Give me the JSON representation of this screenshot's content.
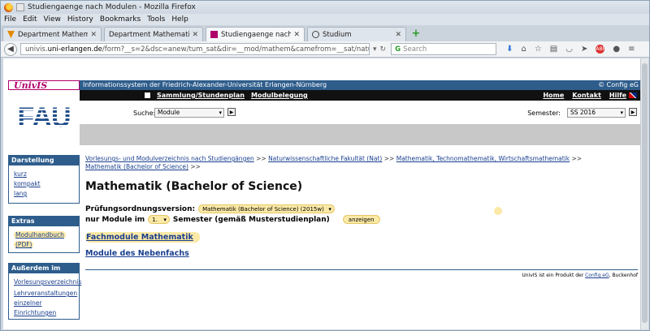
{
  "window": {
    "title": "Studiengaenge nach Modulen - Mozilla Firefox"
  },
  "menu": [
    "File",
    "Edit",
    "View",
    "History",
    "Bookmarks",
    "Tools",
    "Help"
  ],
  "tabs": [
    {
      "label": "Department Mathemati",
      "icon": "v-logo-icon"
    },
    {
      "label": "Department Mathematik > S",
      "icon": "blank-page-icon"
    },
    {
      "label": "Studiengaenge nach Mo",
      "icon": "univis-icon"
    },
    {
      "label": "Studium",
      "icon": "studium-icon"
    }
  ],
  "nav": {
    "url_pre": "univis.",
    "url_domain": "uni-erlangen.de",
    "url_rest": "/form?__s=2&dsc=anew/tum_sat&dir=__mod/mathem&camefrom=__sat/naturw/mathem&",
    "search_placeholder": "Search"
  },
  "univis": {
    "logo": "UnivIS",
    "banner": "Informationssystem der Friedrich-Alexander-Universität Erlangen-Nürnberg",
    "config": "© Config eG",
    "nav_left": [
      "Sammlung/Stundenplan",
      "Modulbelegung"
    ],
    "nav_right": [
      "Home",
      "Kontakt",
      "Hilfe"
    ],
    "search_label": "Suche:",
    "search_value": "Module",
    "semester_label": "Semester:",
    "semester_value": "SS 2016",
    "fau_logo": "FAU"
  },
  "sidebar": {
    "darstellung": {
      "title": "Darstellung",
      "items": [
        "kurz",
        "kompakt",
        "lang"
      ]
    },
    "extras": {
      "title": "Extras",
      "items": [
        "Modulhandbuch",
        "(PDF)"
      ]
    },
    "ausserdem": {
      "title": "Außerdem im UnivIS",
      "items": [
        "Vorlesungsverzeichnis",
        "Lehrveranstaltungen",
        "einzelner",
        "Einrichtungen"
      ]
    }
  },
  "content": {
    "crumbs": [
      "Vorlesungs- und Modulverzeichnis nach Studiengängen",
      "Naturwissenschaftliche Fakultät (Nat)",
      "Mathematik, Technomathematik, Wirtschaftsmathematik",
      "Mathematik (Bachelor of Science)"
    ],
    "crumb_sep": ">>",
    "heading": "Mathematik (Bachelor of Science)",
    "po_label": "Prüfungsordnungsversion:",
    "po_value": "Mathematik (Bachelor of Science) (2015w)",
    "semester_pre": "nur Module im",
    "semester_num": "1.",
    "semester_post": "Semester (gemäß Musterstudienplan)",
    "show_button": "anzeigen",
    "link_fach": "Fachmodule Mathematik",
    "link_neben": "Module des Nebenfachs",
    "footer_pre": "UnivIS ist ein Produkt der",
    "footer_link": "Config eG",
    "footer_post": ", Buckenhof"
  }
}
